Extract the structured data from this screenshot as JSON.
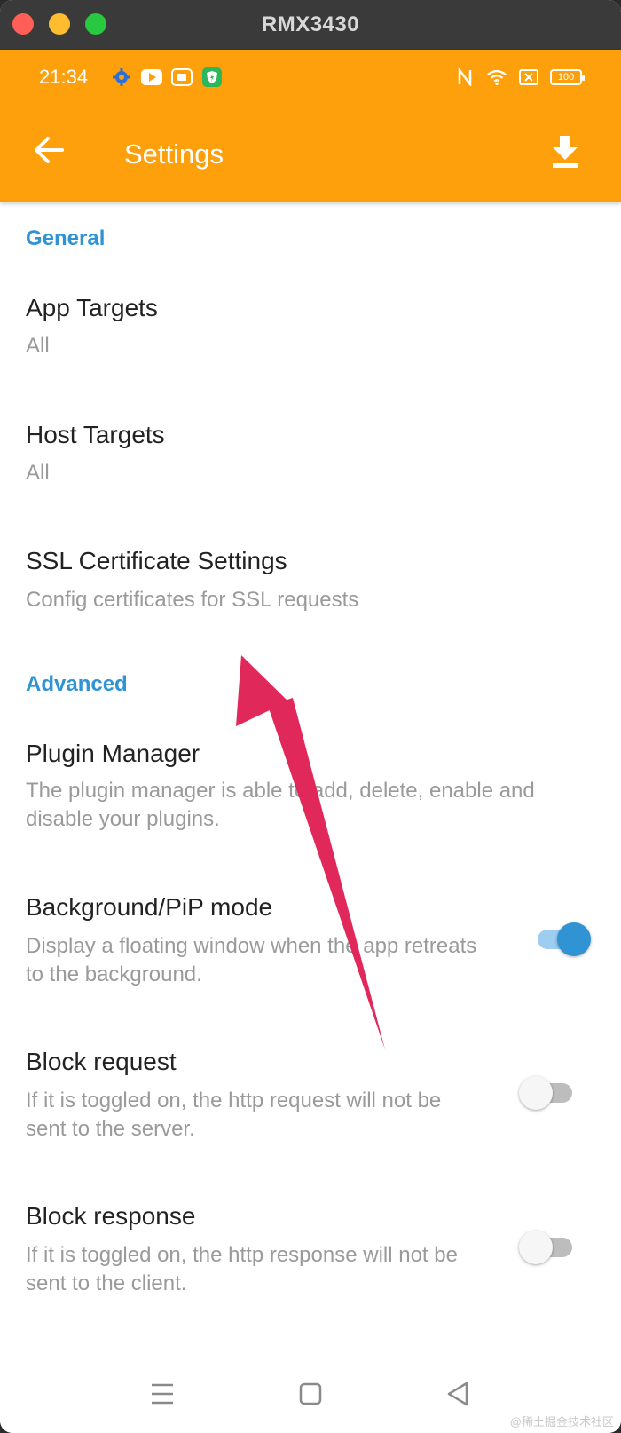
{
  "window": {
    "title": "RMX3430"
  },
  "status_bar": {
    "time": "21:34",
    "battery": "100",
    "left_icons": [
      "gear-icon",
      "youtube-icon",
      "screen-record-icon",
      "shield-icon"
    ],
    "right_icons": [
      "nfc-icon",
      "wifi-icon",
      "sim-x-icon",
      "battery-icon"
    ]
  },
  "app_bar": {
    "title": "Settings"
  },
  "sections": {
    "general": {
      "header": "General",
      "app_targets": {
        "title": "App Targets",
        "summary": "All"
      },
      "host_targets": {
        "title": "Host Targets",
        "summary": "All"
      },
      "ssl": {
        "title": "SSL Certificate Settings",
        "summary": "Config certificates for SSL requests"
      }
    },
    "advanced": {
      "header": "Advanced",
      "plugin_manager": {
        "title": "Plugin Manager",
        "summary": "The plugin manager is able to add, delete, enable and disable your plugins."
      },
      "pip_mode": {
        "title": "Background/PiP mode",
        "summary": "Display a floating window when the app retreats to the background.",
        "enabled": true
      },
      "block_request": {
        "title": "Block request",
        "summary": "If it is toggled on, the http request will not be sent to the server.",
        "enabled": false
      },
      "block_response": {
        "title": "Block response",
        "summary": "If it is toggled on, the http response will not be sent to the client.",
        "enabled": false
      }
    }
  },
  "colors": {
    "app_bar": "#fe9f0c",
    "section_header": "#2f93d4",
    "switch_on": "#2f93d4",
    "annotation_arrow": "#e0285a"
  },
  "watermark": "@稀土掘金技术社区"
}
